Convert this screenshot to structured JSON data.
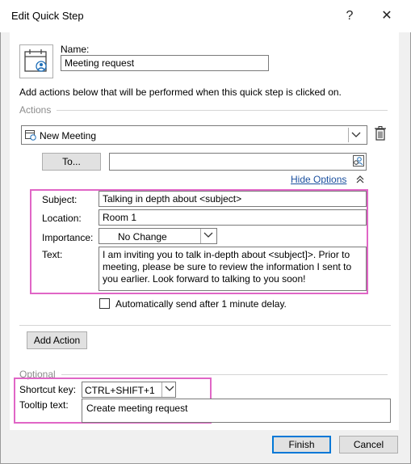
{
  "window": {
    "title": "Edit Quick Step",
    "help_symbol": "?",
    "close_symbol": "✕"
  },
  "name": {
    "label": "Name:",
    "value": "Meeting request"
  },
  "instructions": "Add actions below that will be performed when this quick step is clicked on.",
  "actions": {
    "section_title": "Actions",
    "action_value": "New Meeting",
    "to_button": "To...",
    "to_value": "",
    "hide_options": "Hide Options",
    "subject_label": "Subject:",
    "subject_value": "Talking in depth about <subject>",
    "location_label": "Location:",
    "location_value": "Room 1",
    "importance_label": "Importance:",
    "importance_value": "No Change",
    "text_label": "Text:",
    "text_value": "I am inviting you to talk in-depth about <subject]>. Prior to meeting, please be sure to review the information I sent to you earlier. Look forward to talking to you soon!",
    "auto_send_label": "Automatically send after 1 minute delay.",
    "auto_send_checked": false,
    "add_action_button": "Add Action"
  },
  "optional": {
    "section_title": "Optional",
    "shortcut_label": "Shortcut key:",
    "shortcut_value": "CTRL+SHIFT+1",
    "tooltip_label": "Tooltip text:",
    "tooltip_value": "Create meeting request"
  },
  "footer": {
    "finish_button": "Finish",
    "cancel_button": "Cancel"
  },
  "colors": {
    "highlight": "#e066c6",
    "link": "#1a4f9e",
    "primary_border": "#0078d7"
  }
}
